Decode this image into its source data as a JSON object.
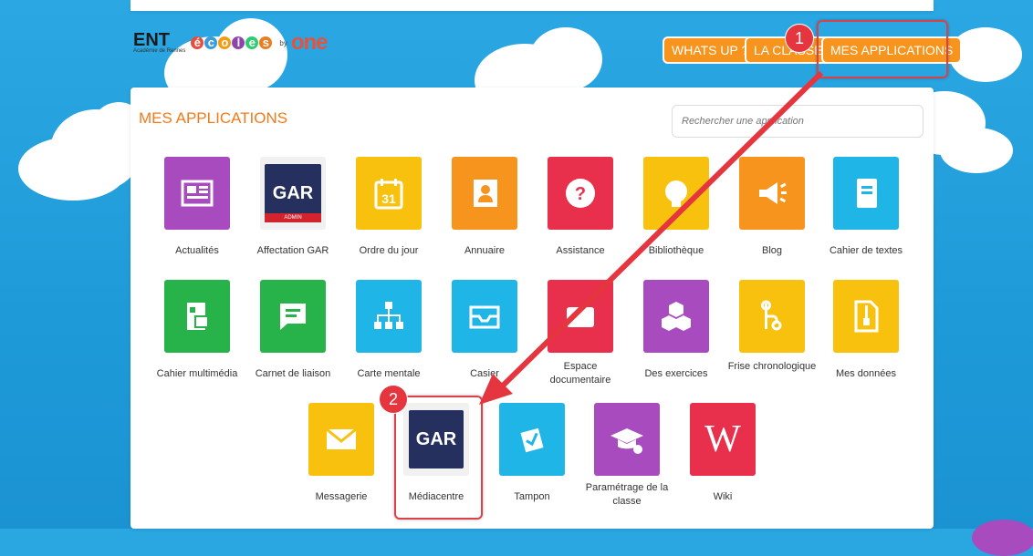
{
  "header": {
    "logo": {
      "ent": "ENT",
      "sub": "Académie de Rennes",
      "ecoles": "écoles",
      "by": "by",
      "one": "one"
    },
    "nav": [
      {
        "label": "WHATS UP ?"
      },
      {
        "label": "LA CLASSE"
      },
      {
        "label": "MES APPLICATIONS"
      }
    ]
  },
  "panel": {
    "title": "MES APPLICATIONS",
    "search_placeholder": "Rechercher une application"
  },
  "apps": {
    "row1": [
      "Actualités",
      "Affectation GAR",
      "Ordre du jour",
      "Annuaire",
      "Assistance",
      "Bibliothèque",
      "Blog",
      "Cahier de textes"
    ],
    "row2": [
      "Cahier multimédia",
      "Carnet de liaison",
      "Carte mentale",
      "Casier",
      "Espace documentaire",
      "Des exercices",
      "Frise chronologique",
      "Mes données"
    ],
    "row3": [
      "Messagerie",
      "Médiacentre",
      "Tampon",
      "Paramétrage de la classe",
      "Wiki"
    ]
  },
  "tile_text": {
    "gar": "GAR",
    "gar_admin": "ADMIN",
    "wiki": "W",
    "calendar": "31"
  },
  "annotations": {
    "step1": "1",
    "step2": "2"
  },
  "colors": {
    "orange": "#f7941e",
    "title_orange": "#f27a1a",
    "annotation_red": "#e5353f",
    "gar_blue": "#26305e"
  }
}
